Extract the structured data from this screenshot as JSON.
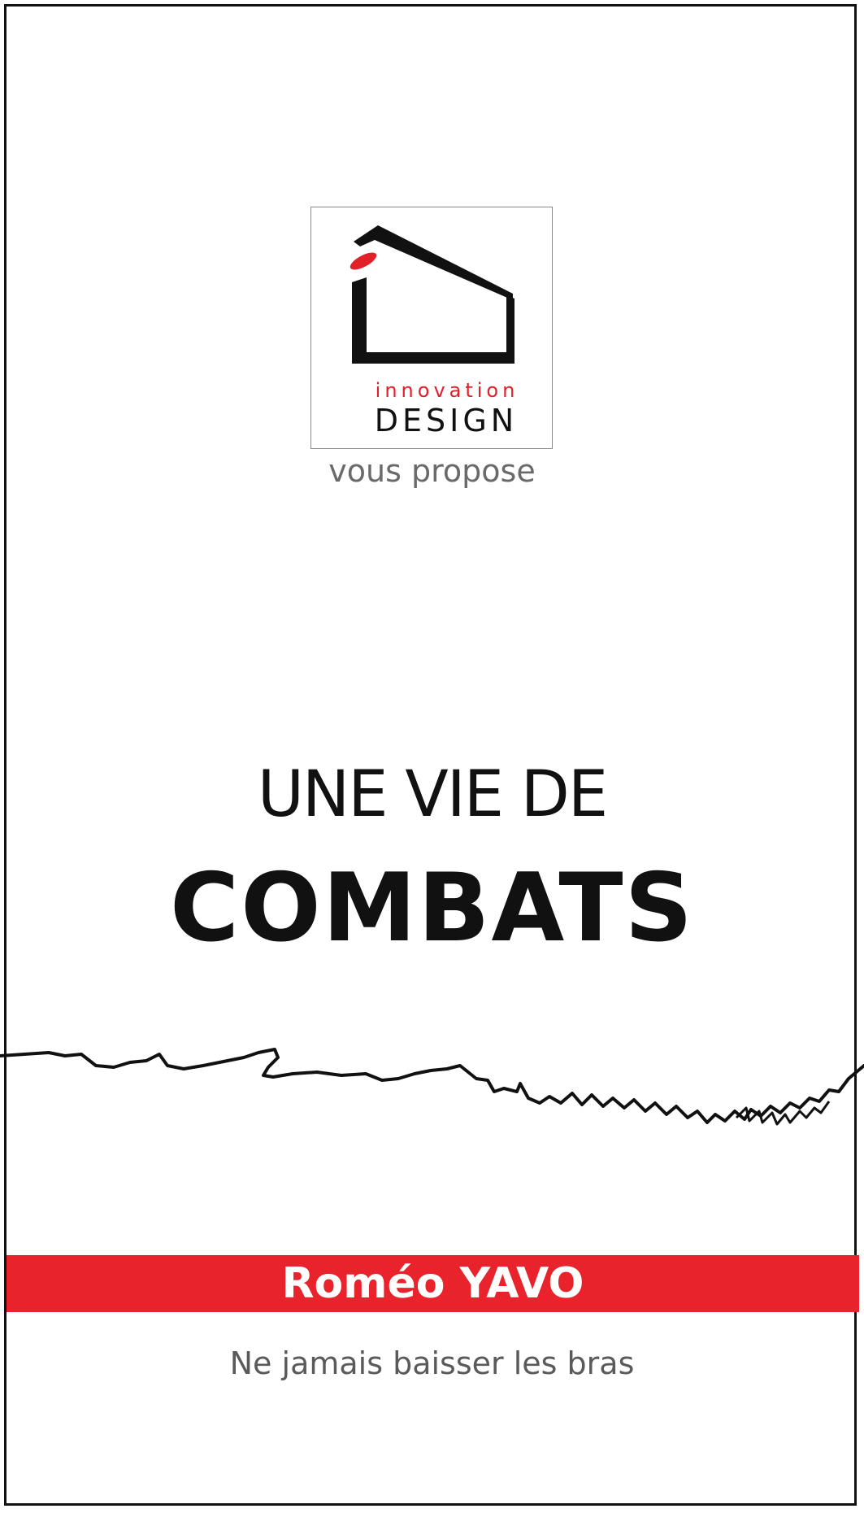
{
  "logo": {
    "brand_top": "innovation",
    "brand_bottom": "DESIGN",
    "icon": "house-outline-icon",
    "accent_color": "#e2202a"
  },
  "intro": "vous propose",
  "title": {
    "line1": "UNE VIE DE",
    "line2": "COMBATS"
  },
  "decoration": {
    "icon": "scribble-line-icon"
  },
  "author": {
    "name": "Roméo YAVO",
    "band_color": "#e8232b"
  },
  "tagline": "Ne jamais baisser les bras"
}
